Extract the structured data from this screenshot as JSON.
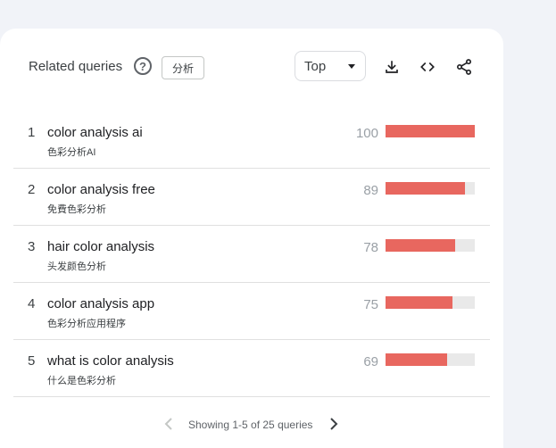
{
  "widget": {
    "title": "Related queries",
    "help_icon": "help-circle-icon",
    "analyze_label": "分析",
    "sort_select": {
      "value": "Top"
    }
  },
  "toolbar": {
    "download_icon": "download-icon",
    "embed_icon": "code-embed-icon",
    "share_icon": "share-icon"
  },
  "rows": [
    {
      "rank": "1",
      "query": "color analysis ai",
      "translation": "色彩分析AI",
      "score": "100",
      "value": 100
    },
    {
      "rank": "2",
      "query": "color analysis free",
      "translation": "免費色彩分析",
      "score": "89",
      "value": 89
    },
    {
      "rank": "3",
      "query": "hair color analysis",
      "translation": "头发颜色分析",
      "score": "78",
      "value": 78
    },
    {
      "rank": "4",
      "query": "color analysis app",
      "translation": "色彩分析应用程序",
      "score": "75",
      "value": 75
    },
    {
      "rank": "5",
      "query": "what is color analysis",
      "translation": "什么是色彩分析",
      "score": "69",
      "value": 69
    }
  ],
  "pagination": {
    "text": "Showing 1-5 of 25 queries",
    "prev_icon": "chevron-left-icon",
    "next_icon": "chevron-right-icon"
  },
  "colors": {
    "bar_fill": "#e8675f",
    "bar_track": "#e9e9e9",
    "card_bg": "#ffffff",
    "page_bg": "#f1f3f8"
  }
}
